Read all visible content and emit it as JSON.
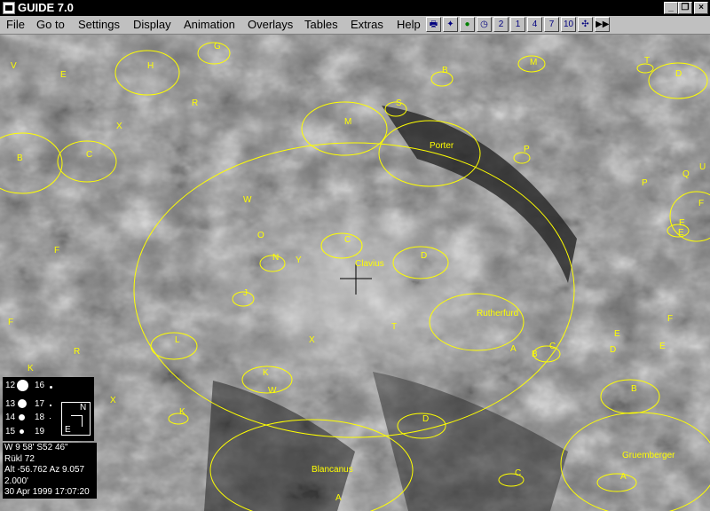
{
  "app": {
    "title": "GUIDE 7.0"
  },
  "menu": [
    "File",
    "Go to",
    "Settings",
    "Display",
    "Animation",
    "Overlays",
    "Tables",
    "Extras",
    "Help"
  ],
  "window_buttons": {
    "minimize": "_",
    "restore": "❐",
    "close": "×"
  },
  "toolbar": [
    {
      "id": "print",
      "icon": "printer-icon",
      "glyph": "🖶"
    },
    {
      "id": "star",
      "icon": "star-map-icon",
      "glyph": "✦"
    },
    {
      "id": "planet",
      "icon": "planet-icon",
      "glyph": "●"
    },
    {
      "id": "clock",
      "icon": "clock-icon",
      "glyph": "◷"
    },
    {
      "id": "z2",
      "icon": "zoom-2-icon",
      "glyph": "2"
    },
    {
      "id": "z1",
      "icon": "zoom-1-icon",
      "glyph": "1"
    },
    {
      "id": "z4",
      "icon": "zoom-4-icon",
      "glyph": "4"
    },
    {
      "id": "z7",
      "icon": "zoom-7-icon",
      "glyph": "7"
    },
    {
      "id": "z10",
      "icon": "zoom-10-icon",
      "glyph": "10"
    },
    {
      "id": "grid",
      "icon": "grid-icon",
      "glyph": "✣"
    },
    {
      "id": "fwd",
      "icon": "fast-forward-icon",
      "glyph": "▶▶"
    }
  ],
  "colors": {
    "overlay": "#ffff00",
    "panel": "#000000"
  },
  "features": {
    "named": [
      "Clavius",
      "Porter",
      "Rutherfurd",
      "Blancanus",
      "Gruemberger"
    ],
    "letters": [
      "V",
      "E",
      "H",
      "G",
      "R",
      "X",
      "B",
      "C",
      "M",
      "S",
      "B",
      "M",
      "T",
      "D",
      "W",
      "O",
      "C",
      "N",
      "Y",
      "D",
      "F",
      "J",
      "F",
      "R",
      "K",
      "L",
      "X",
      "T",
      "A",
      "B",
      "C",
      "K",
      "W",
      "Y",
      "X",
      "K",
      "D",
      "C",
      "A",
      "A",
      "B",
      "D",
      "E",
      "E",
      "F",
      "E",
      "Q",
      "U",
      "P",
      "P",
      "F",
      "E"
    ]
  },
  "legend": {
    "magnitudes": [
      "12",
      "16",
      "13",
      "17",
      "14",
      "18",
      "15",
      "19"
    ],
    "north": "N",
    "east": "E"
  },
  "info": {
    "position": "W  9 58' S52 46\"",
    "rukl": "Rükl 72",
    "altaz": "Alt -56.762  Az 9.057",
    "fov": "2.000'",
    "datetime": "30 Apr 1999 17:07:20"
  }
}
